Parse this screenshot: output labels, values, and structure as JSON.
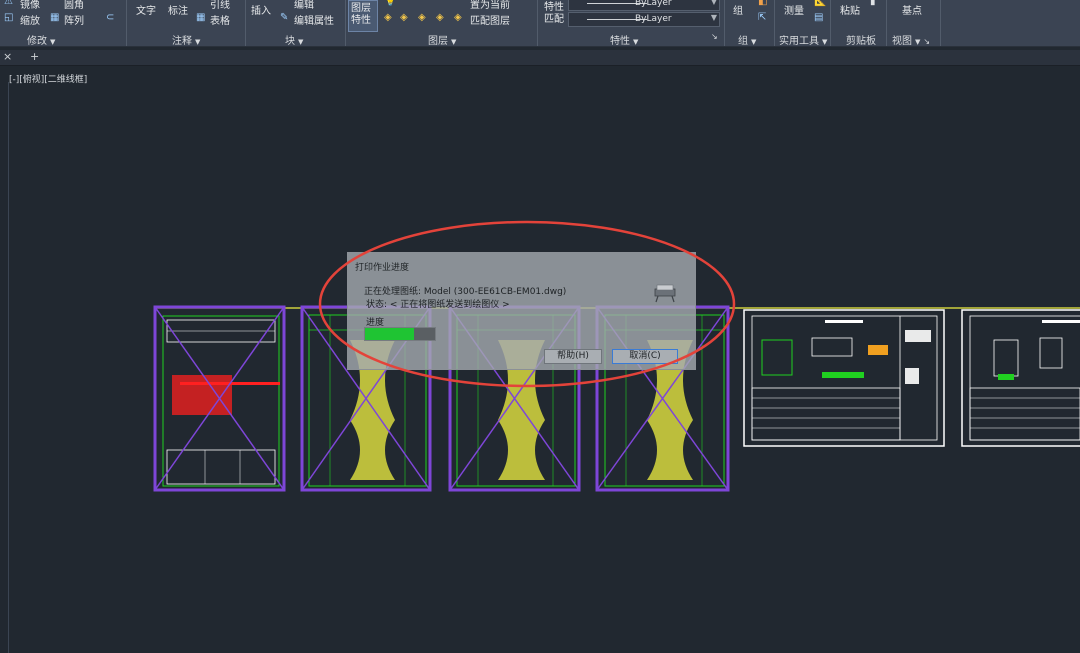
{
  "ribbon": {
    "modify": {
      "mirror": "镜像",
      "fillet": "圆角",
      "scale": "缩放",
      "array": "阵列",
      "title": "修改"
    },
    "annotation": {
      "text": "文字",
      "dimension": "标注",
      "leader": "引线",
      "table": "表格",
      "title": "注释"
    },
    "block": {
      "insert": "插入",
      "edit": "编辑",
      "edit_attributes": "编辑属性",
      "title": "块"
    },
    "layers": {
      "layer_properties": "图层特性",
      "set_current": "置为当前",
      "match_layer": "匹配图层",
      "title": "图层"
    },
    "properties": {
      "match_properties": "特性匹配",
      "color": "ByLayer",
      "linetype": "ByLayer",
      "title": "特性"
    },
    "groups": {
      "group": "组",
      "title": "组"
    },
    "utilities": {
      "measure": "测量",
      "title": "实用工具"
    },
    "clipboard": {
      "paste": "粘贴",
      "title": "剪贴板"
    },
    "view": {
      "base": "基点",
      "title": "视图"
    }
  },
  "tabs": {
    "close": "×",
    "add": "+"
  },
  "viewport": {
    "label": "[-][俯视][二维线框]"
  },
  "dialog": {
    "title": "打印作业进度",
    "processing": "正在处理图纸: Model (300-EE61CB-EM01.dwg)",
    "status": "状态: < 正在将图纸发送到绘图仪 >",
    "progress_label": "进度",
    "progress": 0.7,
    "help_button": "帮助(H)",
    "cancel_button": "取消(C)"
  },
  "colors": {
    "ribbon_bg": "#3b4453",
    "canvas_bg": "#212830",
    "highlight_ellipse": "#e3433a",
    "selection": "#7e46d8",
    "drawing_green": "#20d020",
    "drawing_yellow": "#f0f040",
    "drawing_red": "#ff2020",
    "drawing_white": "#ffffff"
  },
  "icons": [
    "mirror-icon",
    "scale-icon",
    "array-icon",
    "layer-icon",
    "measure-icon",
    "paste-icon",
    "plotter-icon"
  ]
}
